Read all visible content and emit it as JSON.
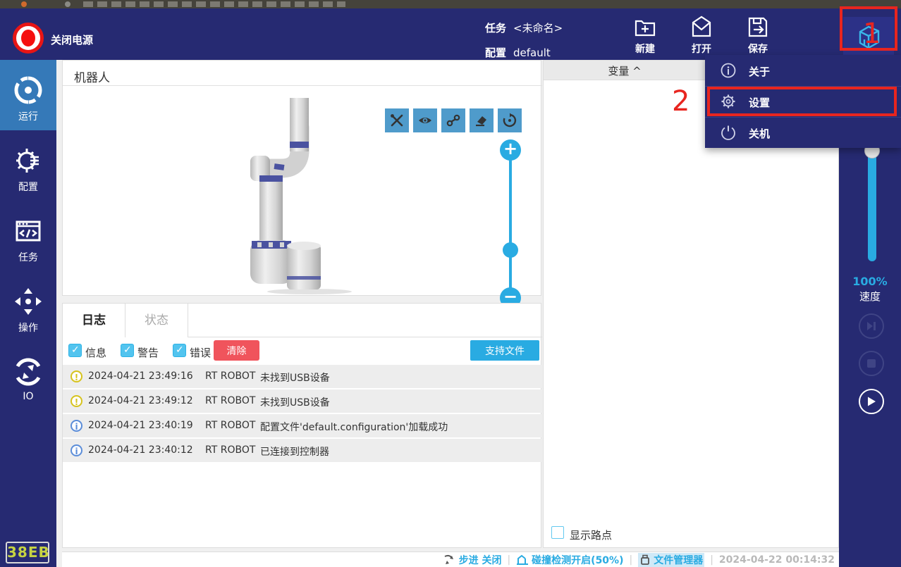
{
  "top_bar": {
    "power_label": "关闭电源",
    "task_label": "任务",
    "task_value": "<未命名>",
    "config_label": "配置",
    "config_value": "default",
    "actions": [
      {
        "label": "新建"
      },
      {
        "label": "打开"
      },
      {
        "label": "保存"
      }
    ]
  },
  "menu": {
    "items": [
      {
        "label": "关于"
      },
      {
        "label": "设置"
      },
      {
        "label": "关机"
      }
    ]
  },
  "annotations": {
    "step1": "1",
    "step2": "2"
  },
  "sidebar": {
    "items": [
      {
        "label": "运行",
        "active": true
      },
      {
        "label": "配置",
        "active": false
      },
      {
        "label": "任务",
        "active": false
      },
      {
        "label": "操作",
        "active": false
      },
      {
        "label": "IO",
        "active": false
      }
    ],
    "badge": "38EB"
  },
  "robot_panel": {
    "title": "机器人"
  },
  "zoom_controls": {
    "plus": "+",
    "minus": "−"
  },
  "log_panel": {
    "tabs": [
      {
        "label": "日志",
        "active": true
      },
      {
        "label": "状态",
        "active": false
      }
    ],
    "filters": [
      {
        "label": "信息",
        "checked": true
      },
      {
        "label": "警告",
        "checked": true
      },
      {
        "label": "错误",
        "checked": true
      }
    ],
    "clear_label": "清除",
    "support_label": "支持文件",
    "entries": [
      {
        "type": "warning",
        "icon": "!",
        "time": "2024-04-21 23:49:16",
        "source": "RT ROBOT",
        "message": "未找到USB设备"
      },
      {
        "type": "warning",
        "icon": "!",
        "time": "2024-04-21 23:49:12",
        "source": "RT ROBOT",
        "message": "未找到USB设备"
      },
      {
        "type": "info",
        "icon": "i",
        "time": "2024-04-21 23:40:19",
        "source": "RT ROBOT",
        "message": "配置文件'default.configuration'加载成功"
      },
      {
        "type": "info",
        "icon": "i",
        "time": "2024-04-21 23:40:12",
        "source": "RT ROBOT",
        "message": "已连接到控制器"
      }
    ]
  },
  "variables_panel": {
    "title": "变量 ^",
    "show_waypoints_label": "显示路点",
    "show_waypoints_checked": false
  },
  "speed_panel": {
    "value": "100%",
    "label": "速度"
  },
  "status_bar": {
    "step_label": "步进 关闭",
    "collision_label": "碰撞检测开启(50%)",
    "file_manager_label": "文件管理器",
    "timestamp": "2024-04-22 00:14:32",
    "separator": "|"
  },
  "colors": {
    "navy": "#262a72",
    "accent_cyan": "#29abe2",
    "active_sidebar": "#3579b8",
    "toolbar_blue": "#4f9bcb",
    "danger_red": "#f0545c",
    "annotation_red": "#e8251f",
    "warning_yellow": "#d6c31d",
    "info_blue": "#5b8dd9",
    "badge_yellow": "#c6d342"
  }
}
